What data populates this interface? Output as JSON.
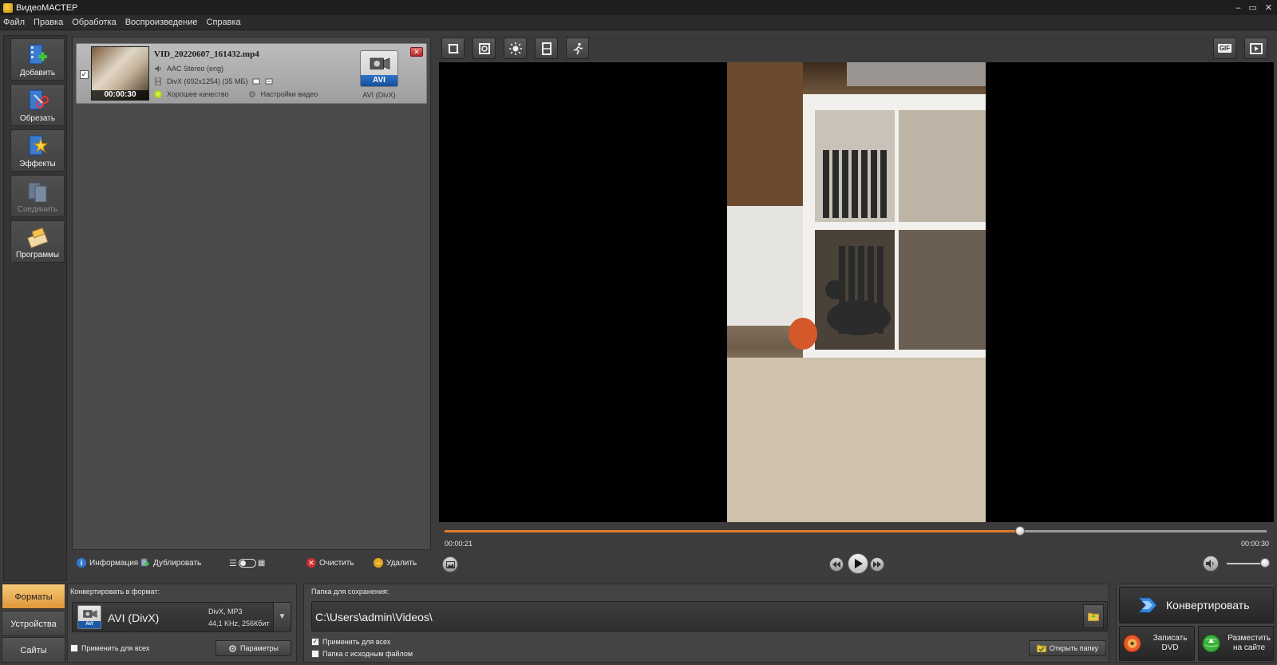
{
  "window": {
    "title": "ВидеоМАСТЕР",
    "controls": [
      "–",
      "▭",
      "✕"
    ]
  },
  "menu": [
    "Файл",
    "Правка",
    "Обработка",
    "Воспроизведение",
    "Справка"
  ],
  "sidebar": {
    "items": [
      {
        "label": "Добавить",
        "icon": "add-film-icon",
        "enabled": true
      },
      {
        "label": "Обрезать",
        "icon": "scissors-film-icon",
        "enabled": true
      },
      {
        "label": "Эффекты",
        "icon": "magic-star-icon",
        "enabled": true
      },
      {
        "label": "Соединить",
        "icon": "join-film-icon",
        "enabled": false
      },
      {
        "label": "Программы",
        "icon": "programs-icon",
        "enabled": true
      }
    ]
  },
  "file": {
    "checked": true,
    "name": "VID_20220607_161432.mp4",
    "duration": "00:00:30",
    "audio": "AAC Stereo (eng)",
    "video": "DivX (692x1254) (35 МБ)",
    "quality": "Хорошее качество",
    "settings": "Настройки видео",
    "format_badge": "AVI",
    "format_caption": "AVI (DivX)"
  },
  "list_toolbar": {
    "info": "Информация",
    "duplicate": "Дублировать",
    "clear": "Очистить",
    "delete": "Удалить"
  },
  "player": {
    "current_time": "00:00:21",
    "total_time": "00:00:30",
    "progress_fraction": 0.7,
    "volume_fraction": 0.95
  },
  "bottom_tabs": [
    "Форматы",
    "Устройства",
    "Сайты"
  ],
  "format": {
    "caption": "Конвертировать в формат:",
    "icon_strip": "AVI",
    "name": "AVI (DivX)",
    "spec_line1": "DivX, MP3",
    "spec_line2": "44,1 KHz, 256Кбит",
    "apply_all": "Применить для всех",
    "params": "Параметры"
  },
  "save": {
    "caption": "Папка для сохранения:",
    "path": "C:\\Users\\admin\\Videos\\",
    "apply_all": "Применить для всех",
    "apply_all_checked": true,
    "source_folder": "Папка с исходным файлом",
    "source_folder_checked": false,
    "open_folder": "Открыть папку"
  },
  "convert": {
    "main": "Конвертировать",
    "dvd_line1": "Записать",
    "dvd_line2": "DVD",
    "site_line1": "Разместить",
    "site_line2": "на сайте"
  },
  "colors": {
    "accent_orange": "#e07a2e",
    "tab_active": "#f0b560",
    "badge_blue": "#1c58a8"
  }
}
